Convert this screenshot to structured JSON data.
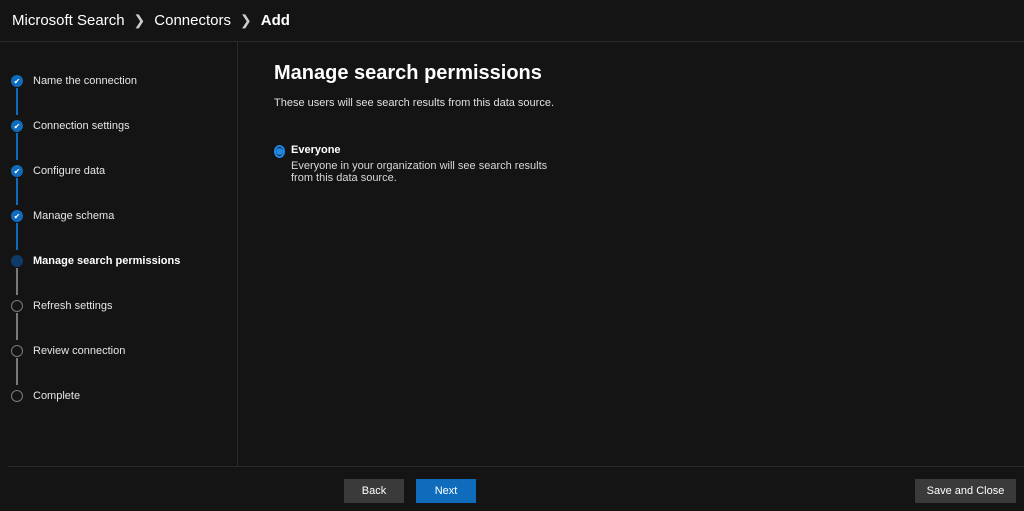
{
  "breadcrumb": [
    "Microsoft Search",
    "Connectors",
    "Add"
  ],
  "steps": [
    {
      "label": "Name the connection",
      "state": "done"
    },
    {
      "label": "Connection settings",
      "state": "done"
    },
    {
      "label": "Configure data",
      "state": "done"
    },
    {
      "label": "Manage schema",
      "state": "done"
    },
    {
      "label": "Manage search permissions",
      "state": "active"
    },
    {
      "label": "Refresh settings",
      "state": "todo"
    },
    {
      "label": "Review connection",
      "state": "todo"
    },
    {
      "label": "Complete",
      "state": "todo"
    }
  ],
  "main": {
    "title": "Manage search permissions",
    "subtitle": "These users will see search results from this data source.",
    "option": {
      "label": "Everyone",
      "description": "Everyone in your organization will see search results from this data source."
    }
  },
  "footer": {
    "back": "Back",
    "next": "Next",
    "save": "Save and Close"
  },
  "colors": {
    "accent": "#0f6cbd"
  }
}
